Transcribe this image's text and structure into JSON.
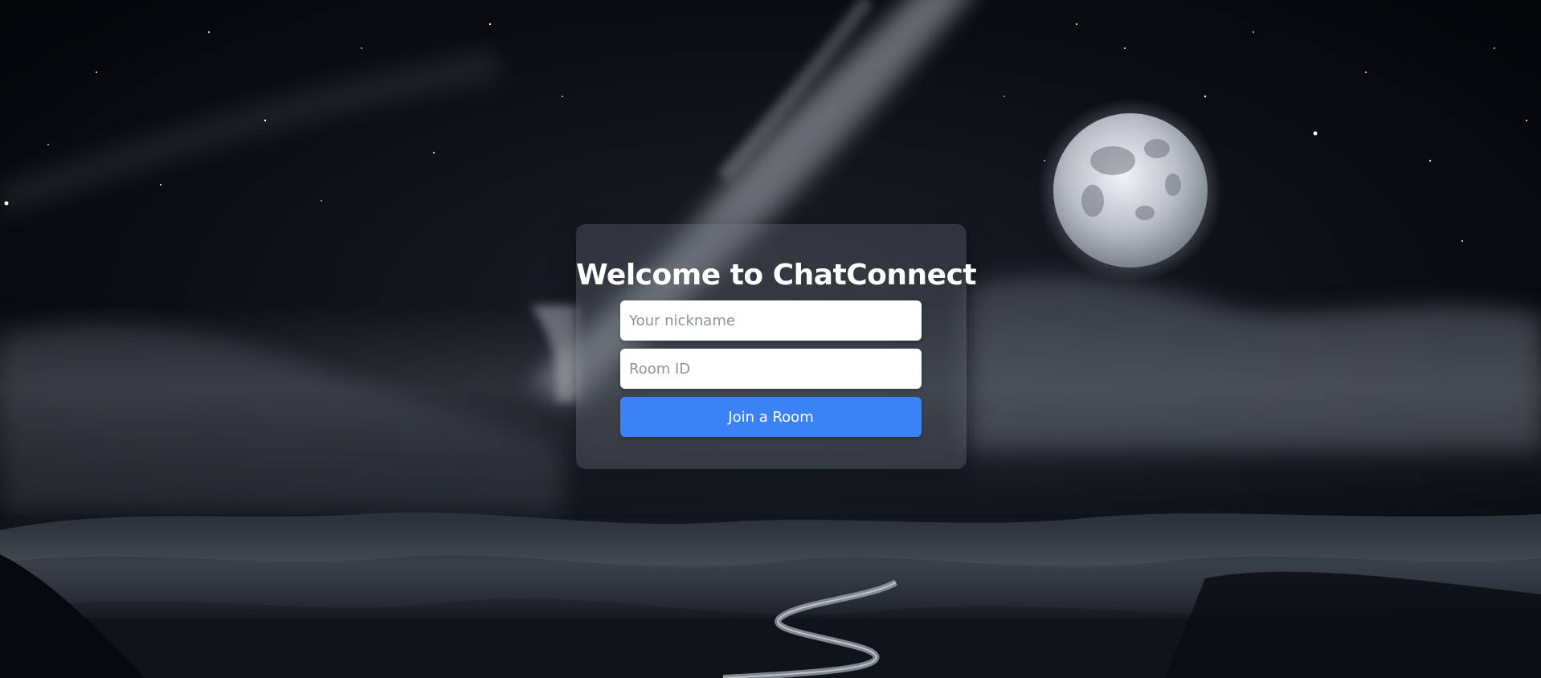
{
  "login": {
    "title": "Welcome to ChatConnect",
    "nickname_placeholder": "Your nickname",
    "nickname_value": "",
    "room_placeholder": "Room ID",
    "room_value": "",
    "join_label": "Join a Room"
  },
  "background": {
    "scene": "night-sky-moon-clouds-mountains-road"
  },
  "colors": {
    "accent": "#3b82f6",
    "card": "#6e737d",
    "input_bg": "#ffffff",
    "title_text": "#ffffff",
    "sky": "#05070b"
  }
}
